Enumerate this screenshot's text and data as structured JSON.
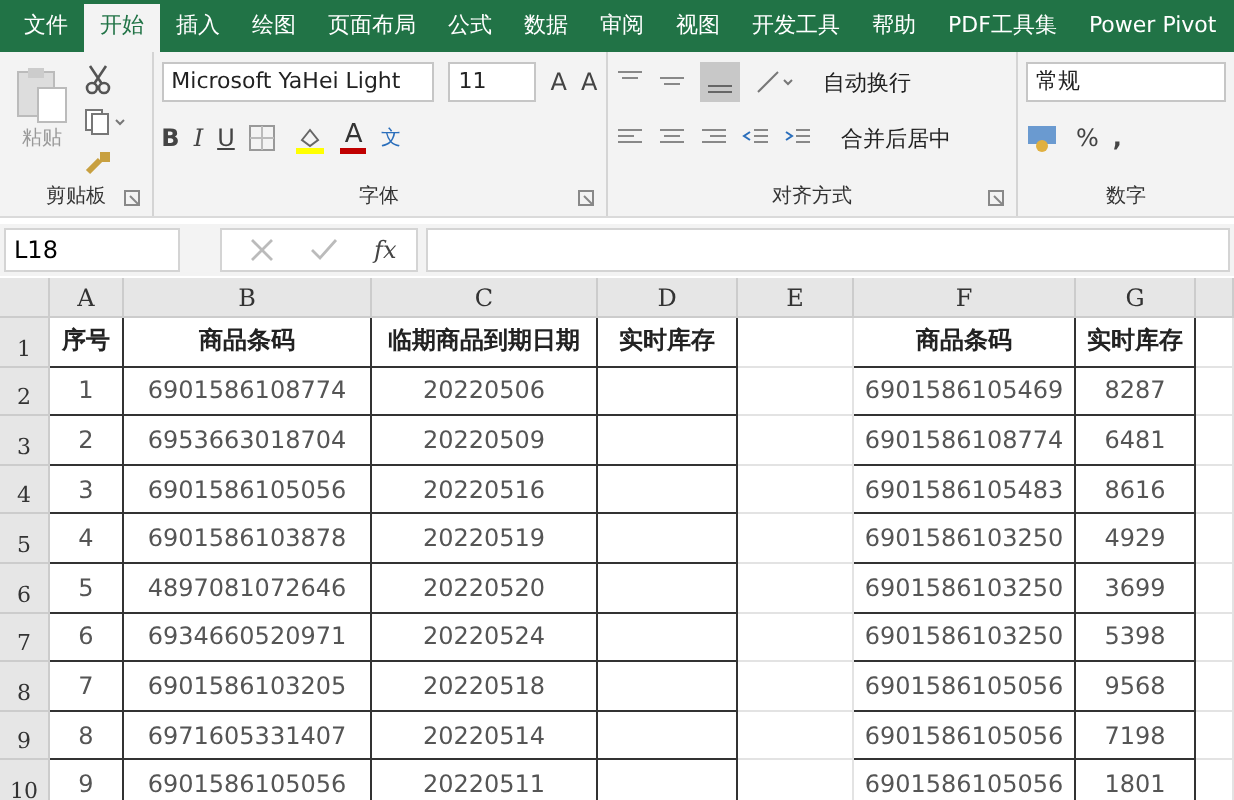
{
  "tabs": [
    {
      "label": "文件",
      "selected": false
    },
    {
      "label": "开始",
      "selected": true
    },
    {
      "label": "插入",
      "selected": false
    },
    {
      "label": "绘图",
      "selected": false
    },
    {
      "label": "页面布局",
      "selected": false
    },
    {
      "label": "公式",
      "selected": false
    },
    {
      "label": "数据",
      "selected": false
    },
    {
      "label": "审阅",
      "selected": false
    },
    {
      "label": "视图",
      "selected": false
    },
    {
      "label": "开发工具",
      "selected": false
    },
    {
      "label": "帮助",
      "selected": false
    },
    {
      "label": "PDF工具集",
      "selected": false
    },
    {
      "label": "Power Pivot",
      "selected": false
    }
  ],
  "ribbon": {
    "clipboard": {
      "paste_label": "粘贴",
      "group_label": "剪贴板"
    },
    "font": {
      "font_name": "Microsoft YaHei Light",
      "font_size": "11",
      "grow_glyph": "A",
      "shrink_glyph": "A",
      "bold_glyph": "B",
      "italic_glyph": "I",
      "underline_glyph": "U",
      "font_color_glyph": "A",
      "phonetic_glyph": "文",
      "group_label": "字体"
    },
    "alignment": {
      "wrap_label": "自动换行",
      "merge_label": "合并后居中",
      "group_label": "对齐方式"
    },
    "number": {
      "format": "常规",
      "percent_glyph": "%",
      "comma_glyph": ",",
      "group_label": "数字"
    }
  },
  "formula_bar": {
    "name_box": "L18",
    "function_glyph": "fx"
  },
  "column_headers": [
    "A",
    "B",
    "C",
    "D",
    "E",
    "F",
    "G"
  ],
  "row_headers": [
    "1",
    "2",
    "3",
    "4",
    "5",
    "6",
    "7",
    "8",
    "9",
    "10"
  ],
  "table_left": {
    "columns": [
      "序号",
      "商品条码",
      "临期商品到期日期",
      "实时库存"
    ],
    "rows": [
      [
        "1",
        "6901586108774",
        "20220506"
      ],
      [
        "2",
        "6953663018704",
        "20220509"
      ],
      [
        "3",
        "6901586105056",
        "20220516"
      ],
      [
        "4",
        "6901586103878",
        "20220519"
      ],
      [
        "5",
        "4897081072646",
        "20220520"
      ],
      [
        "6",
        "6934660520971",
        "20220524"
      ],
      [
        "7",
        "6901586103205",
        "20220518"
      ],
      [
        "8",
        "6971605331407",
        "20220514"
      ],
      [
        "9",
        "6901586105056",
        "20220511"
      ]
    ]
  },
  "table_right": {
    "columns": [
      "商品条码",
      "实时库存"
    ],
    "rows": [
      [
        "6901586105469",
        "8287"
      ],
      [
        "6901586108774",
        "6481"
      ],
      [
        "6901586105483",
        "8616"
      ],
      [
        "6901586103250",
        "4929"
      ],
      [
        "6901586103250",
        "3699"
      ],
      [
        "6901586103250",
        "5398"
      ],
      [
        "6901586105056",
        "9568"
      ],
      [
        "6901586105056",
        "7198"
      ],
      [
        "6901586105056",
        "1801"
      ]
    ]
  }
}
